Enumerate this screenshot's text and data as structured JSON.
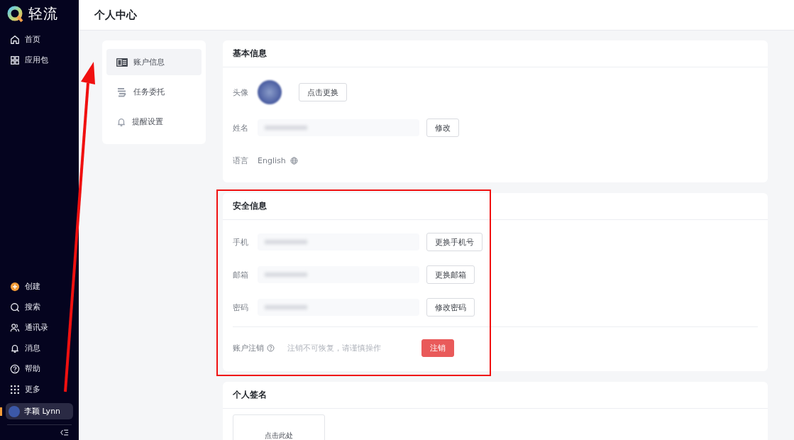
{
  "app": {
    "logo_text": "轻流"
  },
  "sidebar": {
    "top_items": [
      {
        "label": "首页"
      },
      {
        "label": "应用包"
      }
    ],
    "bottom_items": [
      {
        "label": "创建"
      },
      {
        "label": "搜索"
      },
      {
        "label": "通讯录"
      },
      {
        "label": "消息"
      },
      {
        "label": "帮助"
      },
      {
        "label": "更多"
      }
    ],
    "user": {
      "name": "李颖 Lynn",
      "selected": true
    }
  },
  "header": {
    "title": "个人中心"
  },
  "settings_nav": [
    {
      "label": "账户信息",
      "selected": true
    },
    {
      "label": "任务委托",
      "selected": false
    },
    {
      "label": "提醒设置",
      "selected": false
    }
  ],
  "basic_info": {
    "title": "基本信息",
    "avatar_label": "头像",
    "avatar_button": "点击更换",
    "name_label": "姓名",
    "name_button": "修改",
    "language_label": "语言",
    "language_value": "English"
  },
  "security_info": {
    "title": "安全信息",
    "rows": [
      {
        "label": "手机",
        "button": "更换手机号"
      },
      {
        "label": "邮箱",
        "button": "更换邮箱"
      },
      {
        "label": "密码",
        "button": "修改密码"
      }
    ],
    "deactivate": {
      "label": "账户注销",
      "hint": "注销不可恢复，请谨慎操作",
      "button": "注销"
    }
  },
  "signature": {
    "title": "个人签名",
    "upload_text": "点击此处"
  }
}
